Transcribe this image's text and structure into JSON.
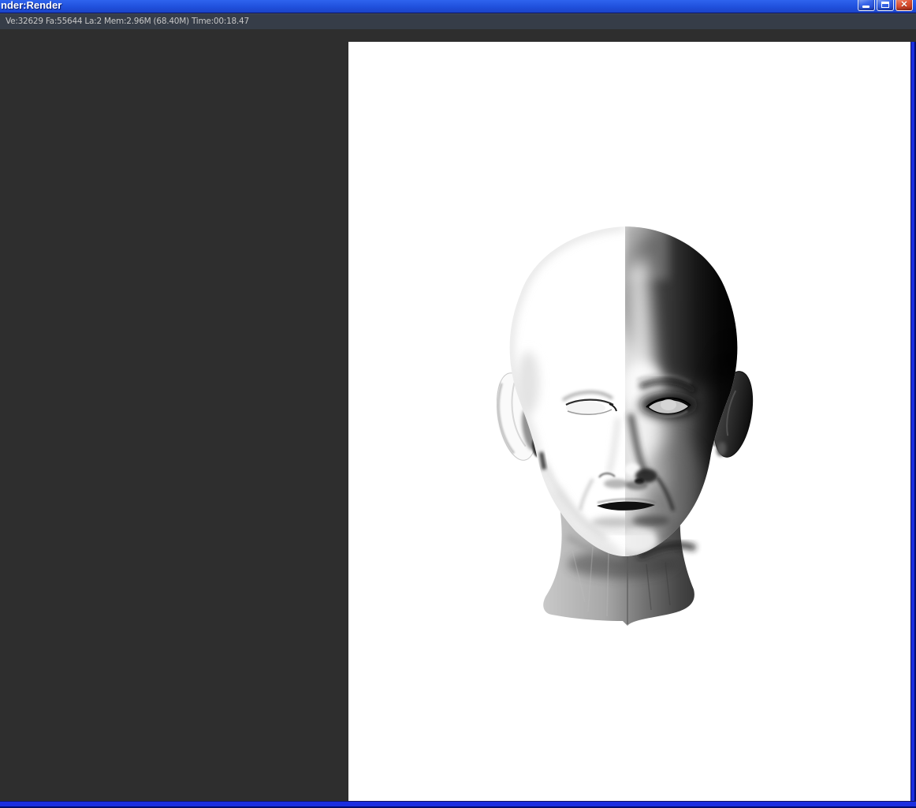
{
  "window": {
    "title": "nder:Render",
    "close_glyph": "✕",
    "control_icons": [
      "minimize-icon",
      "maximize-icon",
      "close-icon"
    ]
  },
  "statusbar": {
    "stats": "Ve:32629 Fa:55644 La:2 Mem:2.96M (68.40M) Time:00:18.47"
  },
  "render_view": {
    "subject_icon": "half-lit-grayscale-head-render"
  },
  "colors": {
    "titlebar_top": "#2e63ee",
    "titlebar_mid": "#2050dc",
    "titlebar_bottom": "#1a43c8",
    "titlebar_line": "#0c1256",
    "statusbar_bg": "#363d48",
    "statusbar_text": "#c6c6c6",
    "viewport_bg": "#2e2e2e",
    "render_bg": "#ffffff",
    "border_blue": "#1b2ee0",
    "border_navy": "#000c72",
    "btn_red_b": "#e2583a",
    "btn_blue_b": "#3b68ea"
  }
}
